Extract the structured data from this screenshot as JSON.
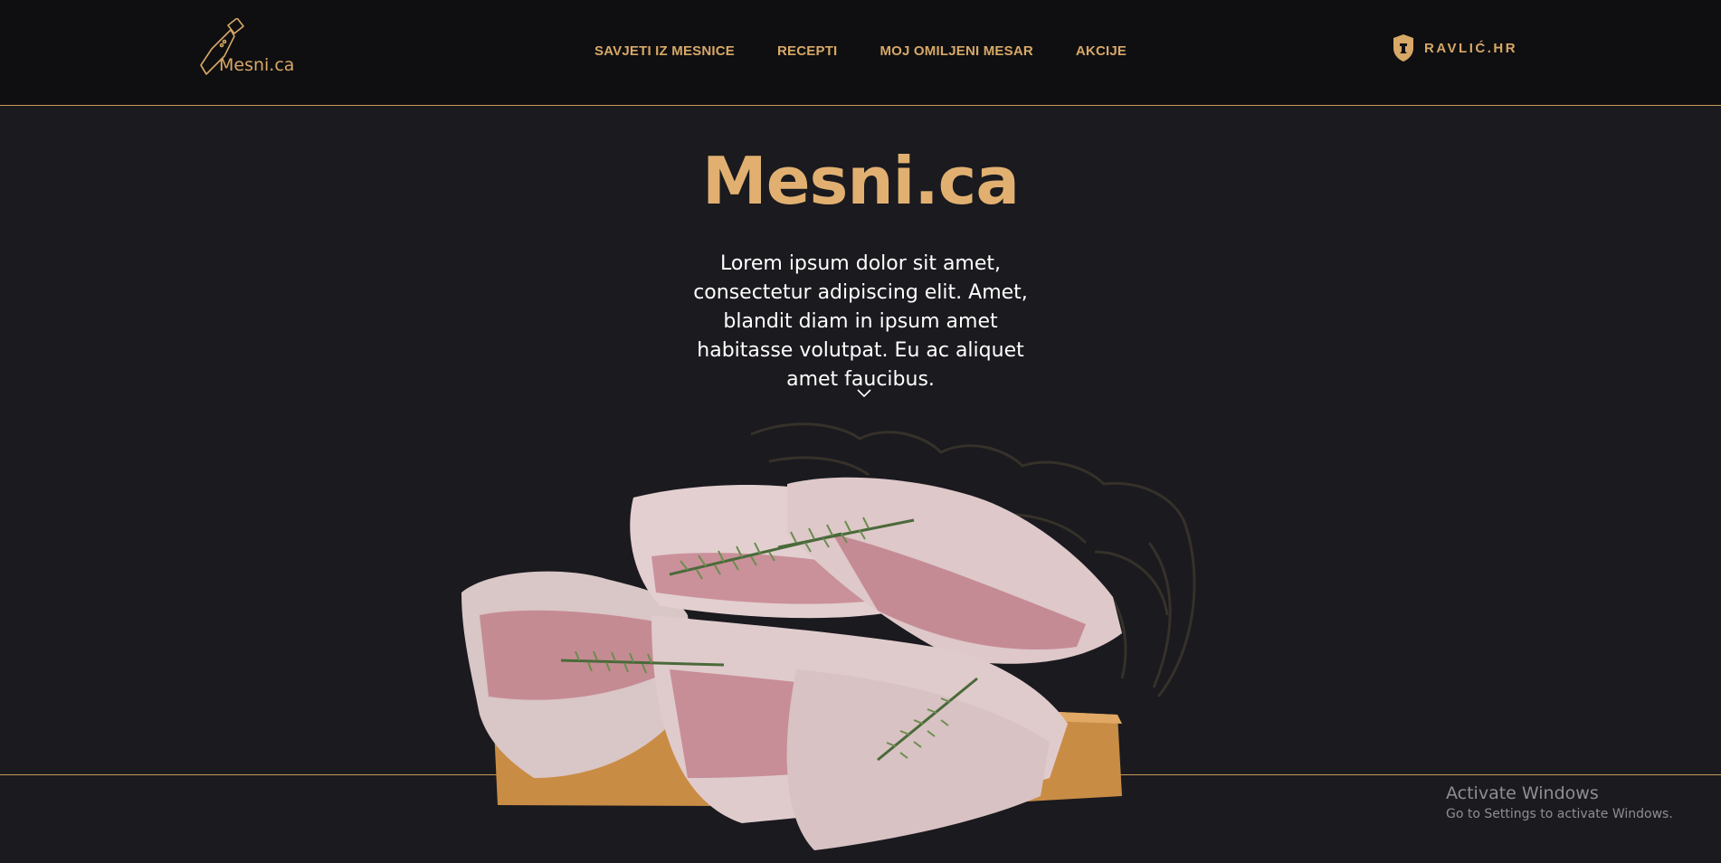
{
  "header": {
    "logo_text": "Mesni.ca",
    "nav": [
      {
        "label": "SAVJETI IZ MESNICE"
      },
      {
        "label": "RECEPTI"
      },
      {
        "label": "MOJ OMILJENI MESAR"
      },
      {
        "label": "AKCIJE"
      }
    ],
    "brand_link": "RAVLIĆ.HR"
  },
  "hero": {
    "title": "Mesni.ca",
    "description": "Lorem ipsum dolor sit amet, consectetur adipiscing elit. Amet, blandit diam in ipsum amet habitasse volutpat. Eu ac aliquet amet faucibus."
  },
  "overlay": {
    "activate_title": "Activate Windows",
    "activate_sub": "Go to Settings to activate Windows."
  },
  "colors": {
    "background": "#1a1a1f",
    "header_bg": "#0f0f11",
    "accent_gold": "#d7a867",
    "text": "#ffffff"
  },
  "icons": {
    "logo": "cleaver-icon",
    "brand": "shield-crest-icon",
    "scroll": "chevron-down-icon"
  }
}
